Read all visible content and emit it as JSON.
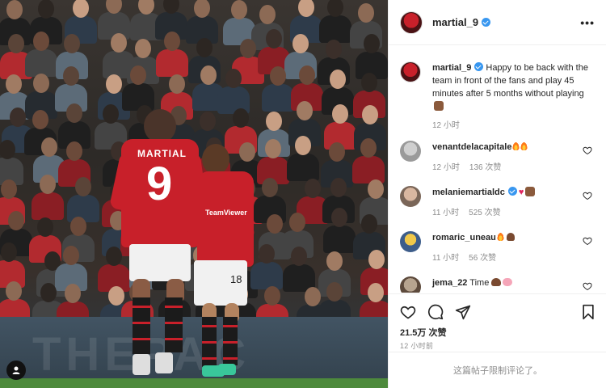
{
  "post": {
    "username": "martial_9",
    "more_icon": "more-horizontal-icon",
    "caption": {
      "username": "martial_9",
      "text": "Happy to be back with the team in front of the fans and play 45 minutes after 5 months without playing",
      "time": "12 小时"
    }
  },
  "photo": {
    "jersey_left_name": "MARTIAL",
    "jersey_left_number": "9",
    "jersey_right_number": "18",
    "sponsor": "TeamViewer"
  },
  "comments": [
    {
      "username": "venantdelacapitale",
      "text": "",
      "time": "12 小时",
      "likes": "136 次赞"
    },
    {
      "username": "melaniemartialdc",
      "text": "",
      "time": "11 小时",
      "likes": "525 次赞"
    },
    {
      "username": "romaric_uneau",
      "text": "",
      "time": "11 小时",
      "likes": "56 次赞"
    },
    {
      "username": "jema_22",
      "text": "Time",
      "time": "",
      "likes": ""
    }
  ],
  "actions": {
    "like_icon": "heart-icon",
    "comment_icon": "comment-icon",
    "share_icon": "send-icon",
    "save_icon": "bookmark-icon"
  },
  "likes": "21.5万 次赞",
  "posted": "12 小时前",
  "comments_limited": "这篇帖子限制评论了。",
  "colors": {
    "verified": "#3897f0",
    "jersey_red": "#c8202a",
    "muted_text": "#8e8e8e"
  }
}
